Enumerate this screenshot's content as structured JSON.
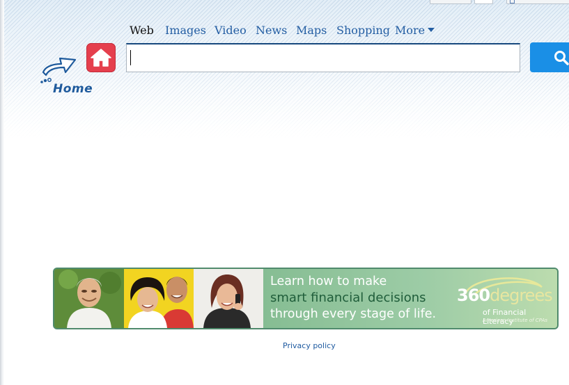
{
  "nav": {
    "tabs": [
      {
        "label": "Web"
      },
      {
        "label": "Images"
      },
      {
        "label": "Video"
      },
      {
        "label": "News"
      },
      {
        "label": "Maps"
      },
      {
        "label": "Shopping"
      },
      {
        "label": "More"
      }
    ],
    "active_tab": "Web"
  },
  "logo": {
    "label": "Home"
  },
  "search": {
    "value": "",
    "placeholder": ""
  },
  "banner": {
    "line1": "Learn how to make",
    "line2": "smart financial decisions",
    "line3": "through every stage of life.",
    "brand_number": "360",
    "brand_word": "degrees",
    "brand_sub": "of Financial Literacy",
    "brand_org": "American Institute of CPAs"
  },
  "footer": {
    "privacy_label": "Privacy policy"
  },
  "colors": {
    "link": "#245ea3",
    "search_button": "#1a8fe6",
    "home_button": "#e53f4d",
    "banner_green": "#8dbf9c",
    "banner_text_dark": "#1f5d3a"
  },
  "icons": [
    "home-arrow-icon",
    "house-icon",
    "search-icon",
    "chevron-down-icon"
  ]
}
